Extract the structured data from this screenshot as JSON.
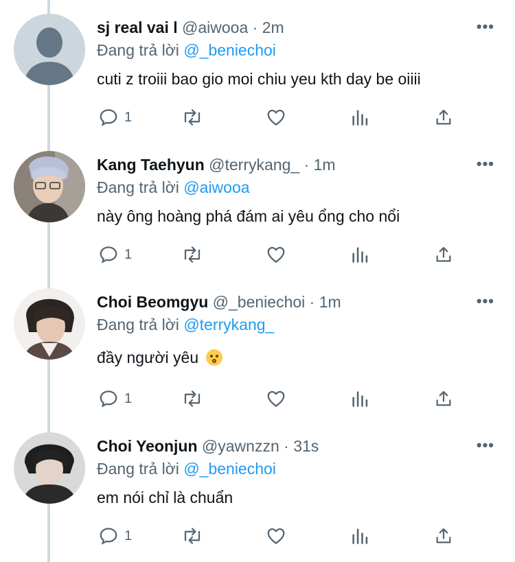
{
  "tweets": [
    {
      "name": "sj real vai l",
      "handle": "@aiwooa",
      "dot": "·",
      "time": "2m",
      "reply_prefix": "Đang trả lời",
      "reply_to": "@_beniechoi",
      "text": "cuti z troiii bao gio moi chiu yeu kth day be oiiii",
      "reply_count": "1",
      "avatar": "default-avatar"
    },
    {
      "name": "Kang Taehyun",
      "handle": "@terrykang_",
      "dot": "·",
      "time": "1m",
      "reply_prefix": "Đang trả lời",
      "reply_to": "@aiwooa",
      "text": "này ông hoàng phá đám ai yêu ổng cho nổi",
      "reply_count": "1",
      "avatar": "photo-avatar"
    },
    {
      "name": "Choi Beomgyu",
      "handle": "@_beniechoi",
      "dot": "·",
      "time": "1m",
      "reply_prefix": "Đang trả lời",
      "reply_to": "@terrykang_",
      "text": "đầy người yêu",
      "emoji": "kissing-face-emoji",
      "reply_count": "1",
      "avatar": "photo-avatar"
    },
    {
      "name": "Choi Yeonjun",
      "handle": "@yawnzzn",
      "dot": "·",
      "time": "31s",
      "reply_prefix": "Đang trả lời",
      "reply_to": "@_beniechoi",
      "text": "em nói chỉ là chuẩn",
      "reply_count": "1",
      "avatar": "photo-avatar"
    }
  ],
  "icons": {
    "reply": "reply-icon",
    "retweet": "retweet-icon",
    "like": "heart-icon",
    "views": "analytics-icon",
    "share": "share-icon",
    "more": "more-icon"
  },
  "colors": {
    "mention": "#1d9bf0",
    "secondary_text": "#536471",
    "thread_line": "#cfd9de"
  }
}
